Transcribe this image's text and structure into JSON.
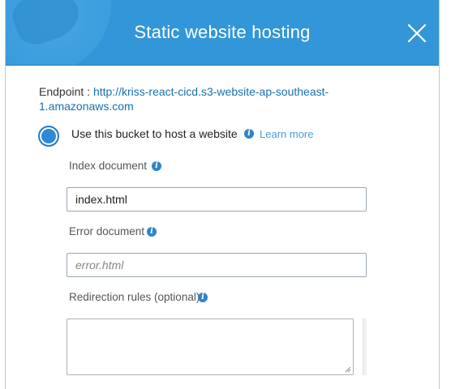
{
  "header": {
    "title": "Static website hosting",
    "close_icon": "close-icon",
    "background": "#3396d8"
  },
  "endpoint": {
    "label": "Endpoint :",
    "url": "http://kriss-react-cicd.s3-website-ap-southeast-1.amazonaws.com"
  },
  "hosting_option": {
    "label": "Use this bucket to host a website",
    "learn_more": "Learn more",
    "selected": true
  },
  "index_document": {
    "label": "Index document",
    "value": "index.html"
  },
  "error_document": {
    "label": "Error document",
    "value": "",
    "placeholder": "error.html"
  },
  "redirection_rules": {
    "label": "Redirection rules (optional)",
    "value": ""
  },
  "colors": {
    "accent": "#3396d8",
    "link": "#1a6fb0",
    "info_icon": "#2f84c7"
  }
}
